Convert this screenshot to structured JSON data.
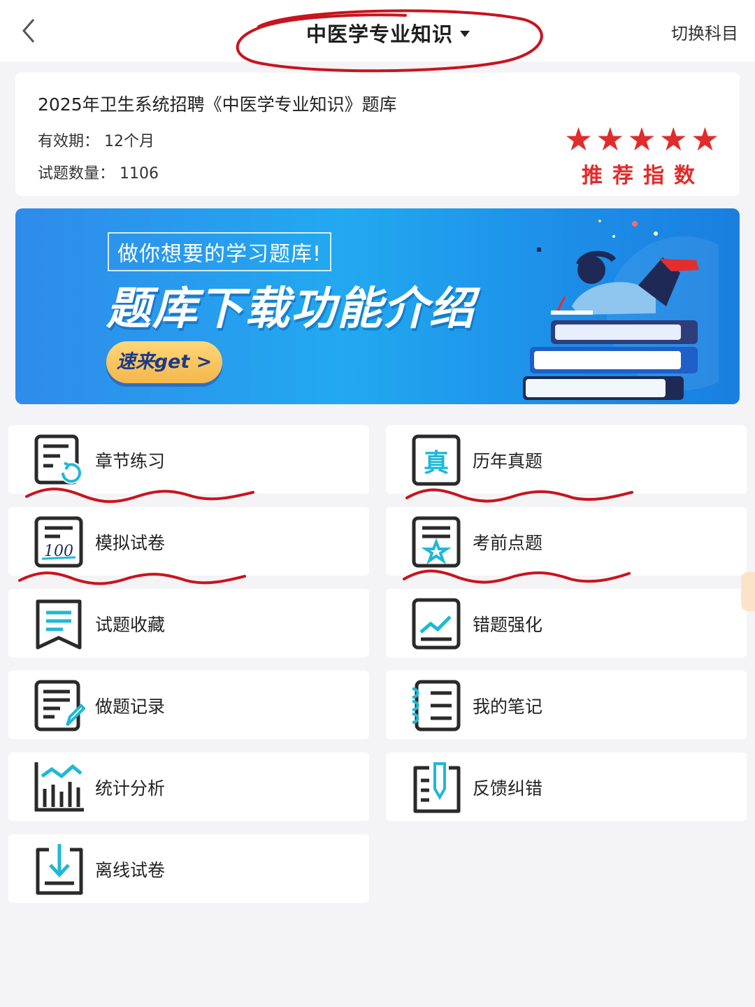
{
  "header": {
    "title": "中医学专业知识",
    "switch_label": "切换科目"
  },
  "info": {
    "bank_name": "2025年卫生系统招聘《中医学专业知识》题库",
    "validity": "有效期：  12个月",
    "count": "试题数量：  1106",
    "stars": "★★★★★",
    "rating_label": "推荐指数"
  },
  "banner": {
    "tag": "做你想要的学习题库!",
    "title": "题库下载功能介绍",
    "button": "速来get >"
  },
  "menu": [
    {
      "label": "章节练习",
      "icon": "chapter-practice-icon"
    },
    {
      "label": "历年真题",
      "icon": "past-exams-icon"
    },
    {
      "label": "模拟试卷",
      "icon": "mock-paper-icon"
    },
    {
      "label": "考前点题",
      "icon": "pre-exam-star-icon"
    },
    {
      "label": "试题收藏",
      "icon": "bookmark-icon"
    },
    {
      "label": "错题强化",
      "icon": "wrong-question-chart-icon"
    },
    {
      "label": "做题记录",
      "icon": "record-edit-icon"
    },
    {
      "label": "我的笔记",
      "icon": "notebook-icon"
    },
    {
      "label": "统计分析",
      "icon": "statistics-icon"
    },
    {
      "label": "反馈纠错",
      "icon": "feedback-icon"
    },
    {
      "label": "离线试卷",
      "icon": "download-icon"
    }
  ],
  "colors": {
    "accent": "#1fb8d6",
    "icon_dark": "#2a2a2a",
    "annotation_red": "#c8141e",
    "star_red": "#e22b2b"
  }
}
